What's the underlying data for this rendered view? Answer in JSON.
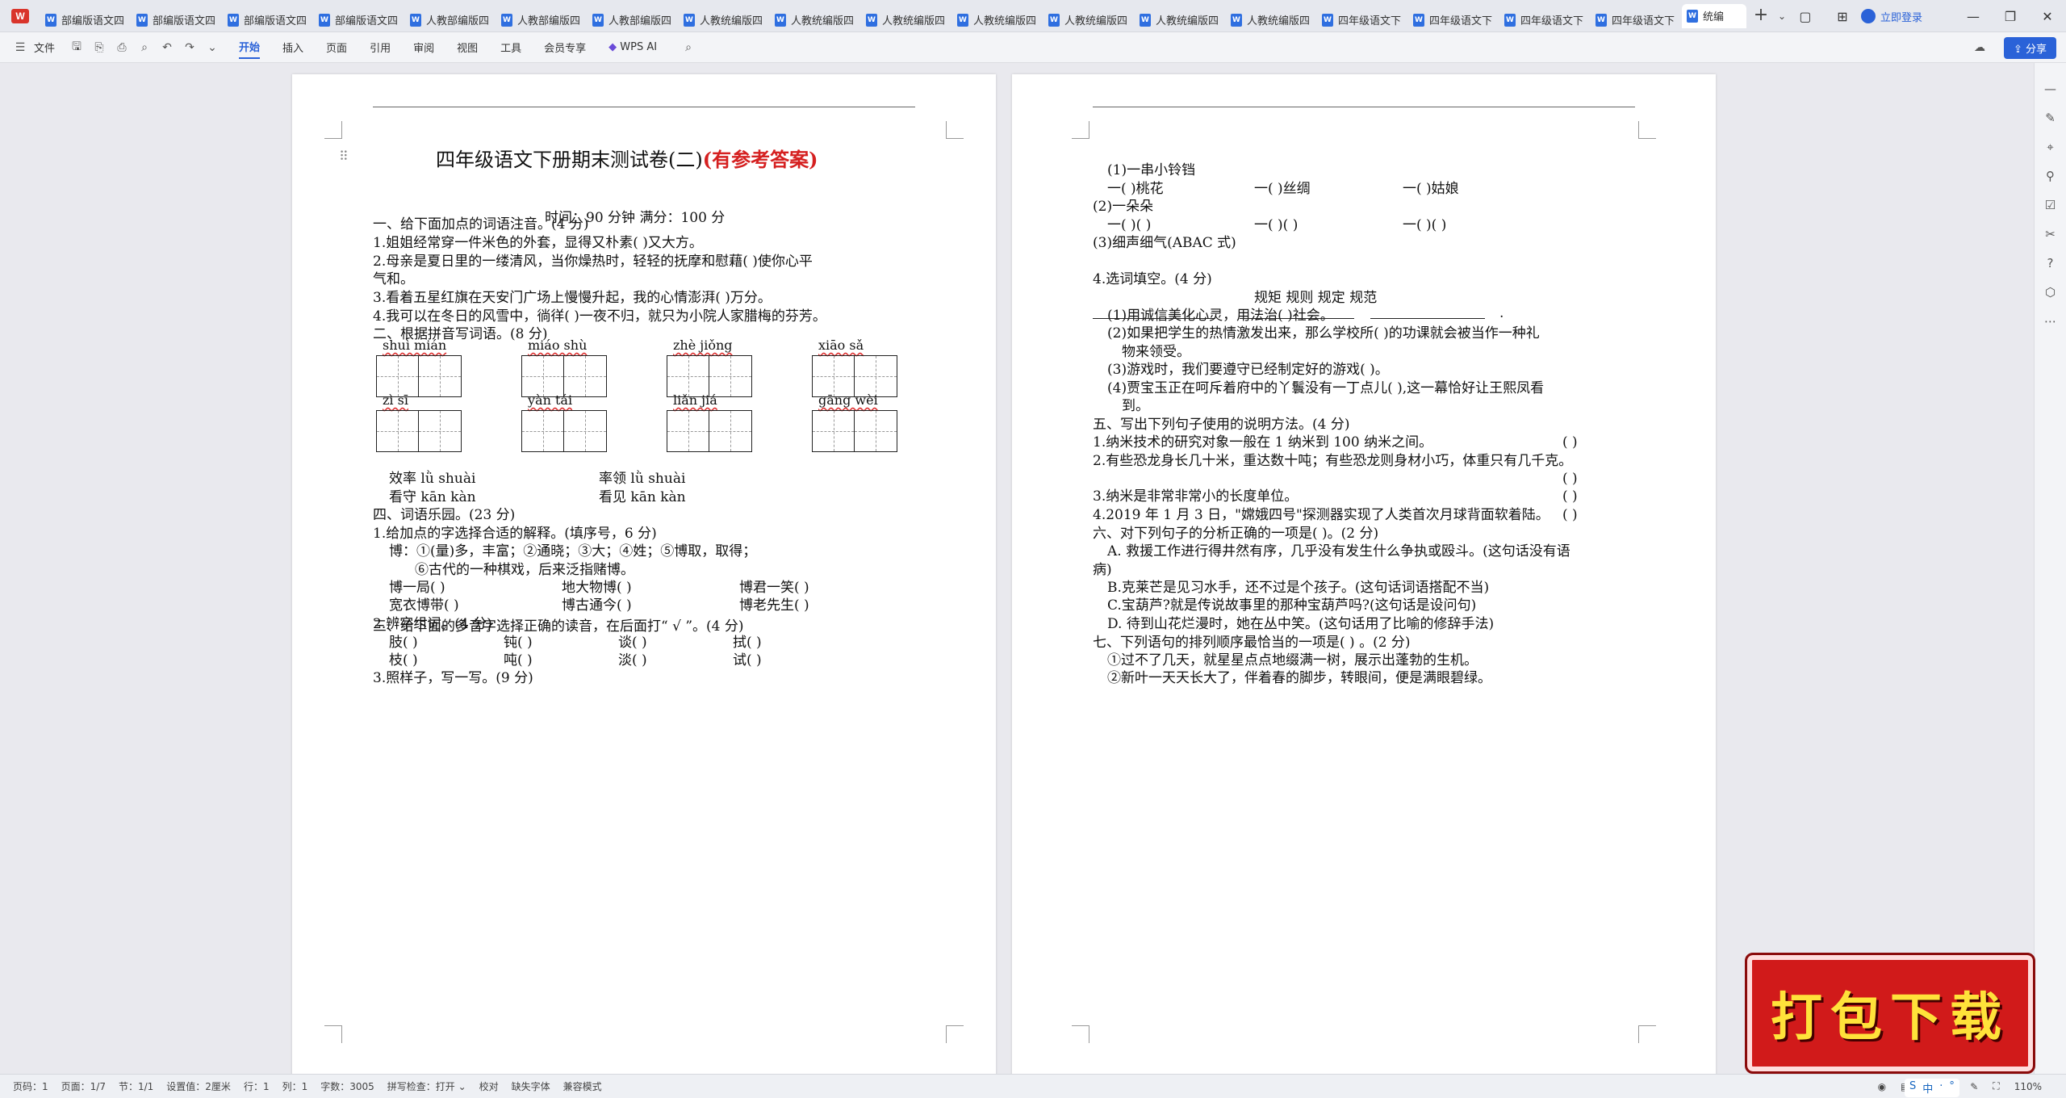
{
  "tabs": {
    "items": [
      "部编版语文四",
      "部编版语文四",
      "部编版语文四",
      "部编版语文四",
      "人教部编版四",
      "人教部编版四",
      "人教部编版四",
      "人教统编版四",
      "人教统编版四",
      "人教统编版四",
      "人教统编版四",
      "人教统编版四",
      "人教统编版四",
      "人教统编版四",
      "四年级语文下",
      "四年级语文下",
      "四年级语文下",
      "四年级语文下"
    ],
    "active": "统编",
    "add": "+",
    "more": "⌄",
    "login": "立即登录"
  },
  "ribbon": {
    "file": "文件",
    "tabs": [
      "开始",
      "插入",
      "页面",
      "引用",
      "审阅",
      "视图",
      "工具",
      "会员专享"
    ],
    "active_tab": "开始",
    "ai": "WPS AI",
    "share": "分享"
  },
  "left_page": {
    "title": "四年级语文下册期末测试卷(二)",
    "title_red": "(有参考答案)",
    "meta": "时间：90 分钟    满分：100 分",
    "lines": [
      "一、给下面加点的词语注音。(4 分)",
      "1.姐姐经常穿一件米色的外套，显得又朴素(            )又大方。",
      "2.母亲是夏日里的一缕清风，当你燥热时，轻轻的抚摩和慰藉(          )使你心平",
      "   气和。",
      "3.看着五星红旗在天安门广场上慢慢升起，我的心情澎湃(        )万分。",
      "4.我可以在冬日的风雪中，徜徉(            )一夜不归，就只为小院人家腊梅的芬芳。",
      "二、根据拼音写词语。(8 分)"
    ],
    "pinyin_row1": [
      "shuì   mián",
      "miáo    shù",
      "zhè   jiǒng",
      "xiāo      sǎ"
    ],
    "pinyin_row2": [
      "zì    sī",
      "yàn    tái",
      "liǎn     jiá",
      "gāng     wèi"
    ],
    "section3": "三、给下面的多音字选择正确的读音，在后面打“ √ ”。(4 分)",
    "poly": [
      "效率 lǜ    shuài",
      "率领 lǜ     shuài",
      "看守 kān    kàn",
      "看见 kān    kàn"
    ],
    "section4": [
      "四、词语乐园。(23 分)",
      "1.给加点的字选择合适的解释。(填序号，6 分)",
      "博：①(量)多，丰富；②通晓；③大；④姓；⑤博取，取得；",
      "⑥古代的一种棋戏，后来泛指赌博。",
      "博一局(      )",
      "地大物博(      )",
      "博君一笑(      )",
      "宽衣博带(      )",
      "博古通今(      )",
      "博老先生(      )",
      "2.辨字组词。(4 分)",
      "肢(          )",
      "钝(          )",
      "谈(          )",
      "拭(          )",
      "枝(          )",
      "吨(          )",
      "淡(          )",
      "试(          )",
      "3.照样子，写一写。(9 分)"
    ]
  },
  "right_page": {
    "lines": [
      "(1)一串小铃铛",
      "一(        )桃花",
      "一(        )丝绸",
      "一(        )姑娘",
      "(2)一朵朵",
      "一(        )(        )",
      "一(        )(        )",
      "一(        )(        )",
      "(3)细声细气(ABAC  式)",
      "4.选词填空。(4 分)",
      "规矩        规则        规定        规范",
      "(1)用诚信美化心灵，用法治(          )社会。",
      "(2)如果把学生的热情激发出来，那么学校所(          )的功课就会被当作一种礼",
      "物来领受。",
      "(3)游戏时，我们要遵守已经制定好的游戏(          )。",
      "(4)贾宝玉正在呵斥着府中的丫鬟没有一丁点儿(          ),这一幕恰好让王熙凤看",
      "到。",
      "五、写出下列句子使用的说明方法。(4 分)",
      "1.纳米技术的研究对象一般在 1 纳米到 100 纳米之间。",
      "2.有些恐龙身长几十米，重达数十吨；有些恐龙则身材小巧，体重只有几千克。",
      "3.纳米是非常非常小的长度单位。",
      "4.2019 年 1 月 3 日，\"嫦娥四号\"探测器实现了人类首次月球背面软着陆。",
      "六、对下列句子的分析正确的一项是(        )。(2 分)",
      "A.  救援工作进行得井然有序，几乎没有发生什么争执或殴斗。(这句话没有语",
      "病)",
      "B.克莱芒是见习水手，还不过是个孩子。(这句话词语搭配不当)",
      "C.宝葫芦?就是传说故事里的那种宝葫芦吗?(这句话是设问句)",
      "D.  待到山花烂漫时，她在丛中笑。(这句话用了比喻的修辞手法)",
      "七、下列语句的排列顺序最恰当的一项是(        ) 。(2 分)",
      "①过不了几天，就星星点点地缀满一树，展示出蓬勃的生机。",
      "②新叶一天天长大了，伴着春的脚步，转眼间，便是满眼碧绿。"
    ],
    "answer_paren": "(            )",
    "period": "."
  },
  "status": {
    "items": [
      "页码：1",
      "页面：1/7",
      "节：1/1",
      "设置值：2厘米",
      "行：1",
      "列：1",
      "字数：3005",
      "拼写检查：打开 ⌄",
      "校对",
      "缺失字体",
      "兼容模式"
    ],
    "zoom": "110%"
  },
  "banner": {
    "text": "打包下载"
  },
  "ime": [
    "S",
    "中",
    "·",
    "°"
  ]
}
